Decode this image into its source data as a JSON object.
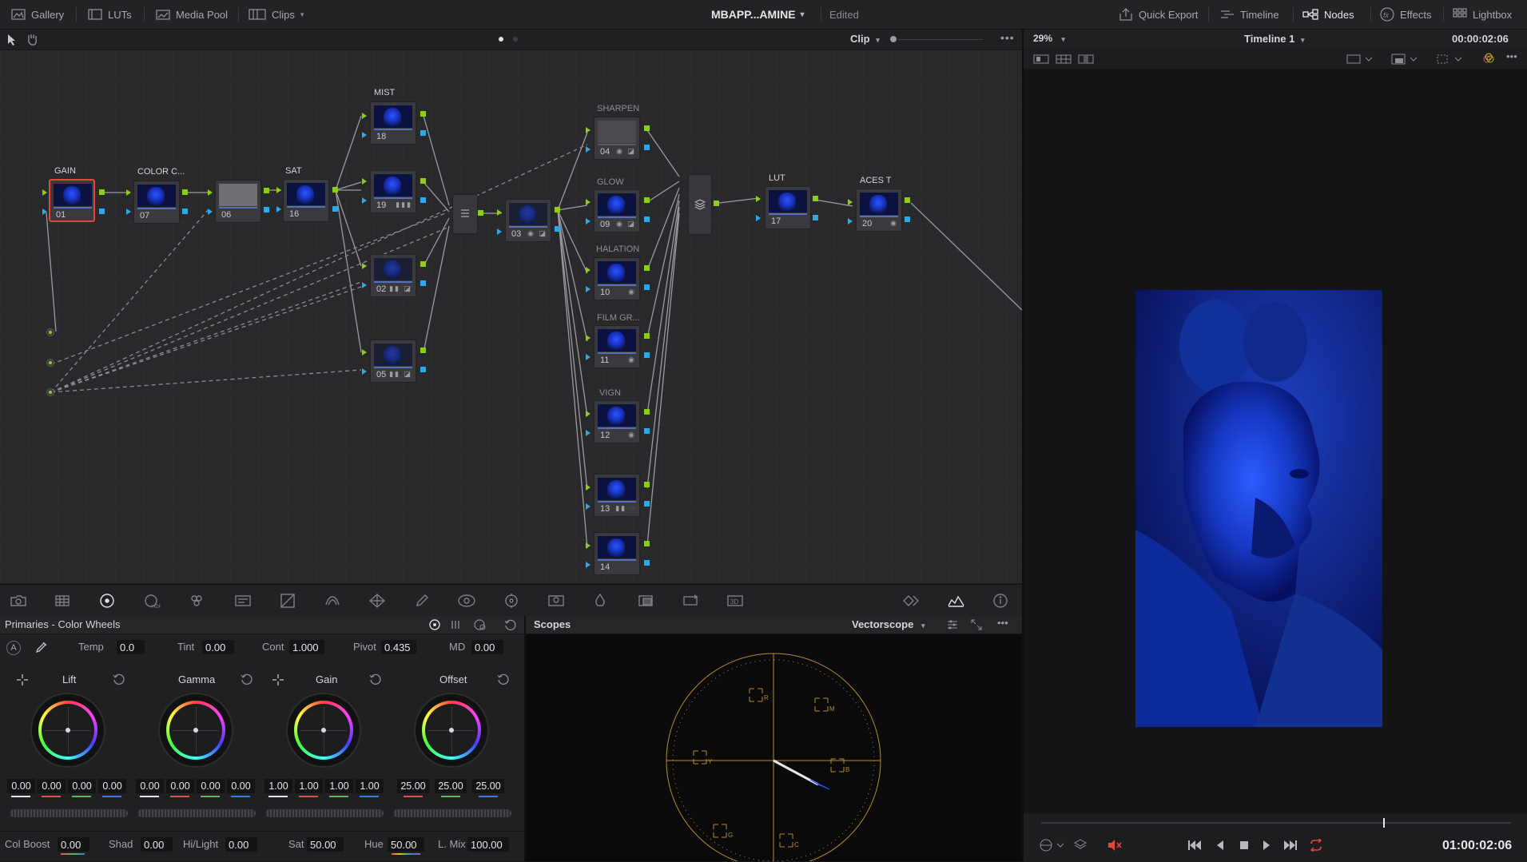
{
  "topbar": {
    "left_items": [
      "Gallery",
      "LUTs",
      "Media Pool",
      "Clips"
    ],
    "project_title": "MBAPP...AMINE",
    "project_status": "Edited",
    "right_items": [
      "Quick Export",
      "Timeline",
      "Nodes",
      "Effects",
      "Lightbox"
    ]
  },
  "node_toolbar": {
    "mode": "Clip"
  },
  "viewer_bar": {
    "zoom": "29%",
    "timeline": "Timeline 1",
    "timecode": "00:00:02:06"
  },
  "nodes": [
    {
      "num": "01",
      "label": "GAIN"
    },
    {
      "num": "07",
      "label": "COLOR C..."
    },
    {
      "num": "06",
      "label": ""
    },
    {
      "num": "16",
      "label": "SAT"
    },
    {
      "num": "18",
      "label": "MIST"
    },
    {
      "num": "19",
      "label": ""
    },
    {
      "num": "02",
      "label": ""
    },
    {
      "num": "05",
      "label": ""
    },
    {
      "num": "03",
      "label": ""
    },
    {
      "num": "04",
      "label": "SHARPEN"
    },
    {
      "num": "09",
      "label": "GLOW"
    },
    {
      "num": "10",
      "label": "HALATION"
    },
    {
      "num": "11",
      "label": "FILM GR..."
    },
    {
      "num": "12",
      "label": "VIGN"
    },
    {
      "num": "13",
      "label": ""
    },
    {
      "num": "14",
      "label": ""
    },
    {
      "num": "17",
      "label": "LUT"
    },
    {
      "num": "20",
      "label": "ACES T"
    }
  ],
  "primaries": {
    "title": "Primaries - Color Wheels",
    "mode_badge": "A",
    "params_top": [
      {
        "label": "Temp",
        "value": "0.0"
      },
      {
        "label": "Tint",
        "value": "0.00"
      },
      {
        "label": "Cont",
        "value": "1.000"
      },
      {
        "label": "Pivot",
        "value": "0.435"
      },
      {
        "label": "MD",
        "value": "0.00"
      }
    ],
    "wheels": [
      {
        "name": "Lift",
        "values": [
          "0.00",
          "0.00",
          "0.00",
          "0.00"
        ]
      },
      {
        "name": "Gamma",
        "values": [
          "0.00",
          "0.00",
          "0.00",
          "0.00"
        ]
      },
      {
        "name": "Gain",
        "values": [
          "1.00",
          "1.00",
          "1.00",
          "1.00"
        ]
      },
      {
        "name": "Offset",
        "values": [
          "25.00",
          "25.00",
          "25.00"
        ]
      }
    ],
    "params_bottom": [
      {
        "label": "Col Boost",
        "value": "0.00"
      },
      {
        "label": "Shad",
        "value": "0.00"
      },
      {
        "label": "Hi/Light",
        "value": "0.00"
      },
      {
        "label": "Sat",
        "value": "50.00"
      },
      {
        "label": "Hue",
        "value": "50.00"
      },
      {
        "label": "L. Mix",
        "value": "100.00"
      }
    ]
  },
  "scopes": {
    "title": "Scopes",
    "type": "Vectorscope",
    "targets": [
      "R",
      "M",
      "Y",
      "B",
      "G",
      "C"
    ]
  },
  "transport": {
    "timecode": "01:00:02:06"
  },
  "colors": {
    "accent_green": "#8dcc1d",
    "accent_blue": "#2fa8e6",
    "selected_red": "#e2473a",
    "scope_gold": "#b88a2c"
  }
}
